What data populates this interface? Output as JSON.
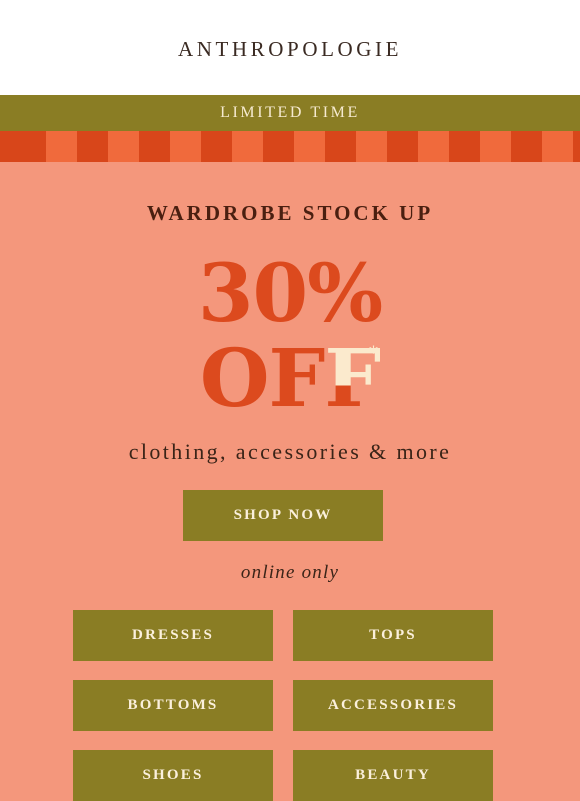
{
  "brand": {
    "logo_text": "ANTHROPOLOGIE"
  },
  "banner": {
    "text": "LIMITED TIME"
  },
  "promo": {
    "subhead": "WARDROBE STOCK UP",
    "discount_line1": "30%",
    "discount_line2_prefix": "OF",
    "discount_line2_highlight": "F",
    "asterisk": "*",
    "tagline": "clothing, accessories & more"
  },
  "cta": {
    "shop_now_label": "SHOP NOW",
    "note": "online only"
  },
  "categories": [
    {
      "label": "DRESSES"
    },
    {
      "label": "TOPS"
    },
    {
      "label": "BOTTOMS"
    },
    {
      "label": "ACCESSORIES"
    },
    {
      "label": "SHOES"
    },
    {
      "label": "BEAUTY"
    }
  ],
  "colors": {
    "background": "#f4977c",
    "olive": "#8a7d24",
    "accent_orange": "#dc4a1e",
    "cream": "#fbeacd"
  }
}
